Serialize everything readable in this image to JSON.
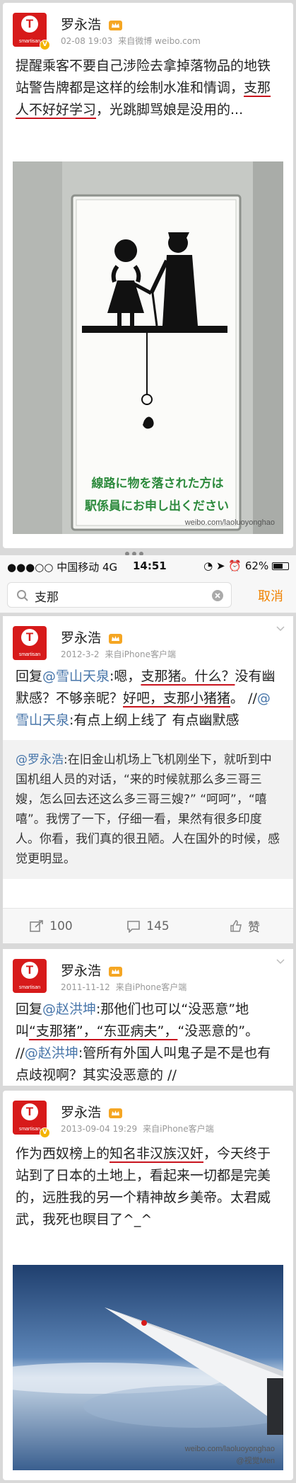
{
  "post1": {
    "user": "罗永浩",
    "date": "02-08 19:03",
    "source": "来自微博 weibo.com",
    "text_a": "提醒乘客不要自己涉险去拿掉落物品的地铁站警告牌都是这样的绘制水准和情调，",
    "text_hl": "支那人不好好学习",
    "text_b": "，光跳脚骂娘是没用的...",
    "sign_line1": "線路に物を落された方は",
    "sign_line2": "駅係員にお申し出ください",
    "watermark": "weibo.com/laoluoyonghao"
  },
  "avatar": {
    "letter": "T",
    "sub": "smartisan",
    "verified": "V"
  },
  "status": {
    "carrier": "中国移动  4G",
    "time": "14:51",
    "battery": "62%"
  },
  "search": {
    "value": "支那",
    "cancel": "取消"
  },
  "result1": {
    "user": "罗永浩",
    "date": "2012-3-2",
    "source": "来自iPhone客户端",
    "reply_prefix": "回复",
    "mention1": "@雪山天泉",
    "t1": ":嗯，",
    "hl1": "支那猪。什么？",
    "t2": "没有幽默感？不够亲昵？",
    "hl2": "好吧，支那小猪猪",
    "t3": "。 //",
    "mention2": "@雪山天泉",
    "t4": ":有点上纲上线了 有点幽默感",
    "repost_mention": "@罗永浩",
    "repost_text": ":在旧金山机场上飞机刚坐下，就听到中国机组人员的对话，“来的时候就那么多三哥三嫂，怎么回去还这么多三哥三嫂?” “呵呵”，“嘻嘻”。我愣了一下，仔细一看，果然有很多印度人。你看，我们真的很丑陋。人在国外的时候，感觉更明显。",
    "reposts": "100",
    "comments": "145",
    "likes": "赞"
  },
  "result2": {
    "user": "罗永浩",
    "date": "2011-11-12",
    "source": "来自iPhone客户端",
    "reply_prefix": "回复",
    "mention1": "@赵洪坤",
    "t1": ":那他们也可以“没恶意”地叫",
    "hl1": "“支那猪”，“东亚病夫”，",
    "t2": "“没恶意的”。 //",
    "mention2": "@赵洪坤",
    "t3": ":管所有外国人叫鬼子是不是也有点歧视啊？其实没恶意的 //"
  },
  "post3": {
    "user": "罗永浩",
    "date": "2013-09-04 19:29",
    "source": "来自iPhone客户端",
    "t1": "作为西奴榜上的",
    "hl1": "知名非汉族汉奸",
    "t2": "，今天终于站到了日本的土地上，看起来一切都是完美的，远胜我的另一个精神故乡美帝。太君威武，我死也瞑目了^_^",
    "watermark": "weibo.com/laoluoyonghao",
    "credit": "@视觉Men"
  },
  "colors": {
    "accent": "#d71a1a",
    "link": "#4876aa",
    "cancel": "#f08200",
    "sign_green": "#2e8b3e"
  }
}
